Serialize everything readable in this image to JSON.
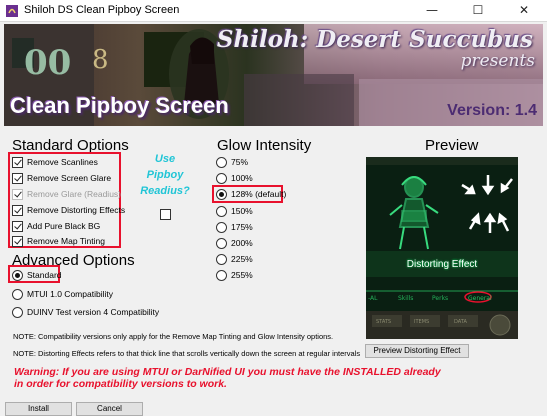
{
  "window": {
    "title": "Shiloh DS Clean Pipboy Screen",
    "minimize_glyph": "—",
    "maximize_glyph": "☐",
    "close_glyph": "✕"
  },
  "banner": {
    "headline": "Shiloh: Desert Succubus",
    "presents": "presents",
    "title": "Clean Pipboy Screen",
    "version": "Version: 1.4"
  },
  "standard_options": {
    "heading": "Standard Options",
    "items": [
      {
        "label": "Remove Scanlines",
        "checked": true,
        "enabled": true
      },
      {
        "label": "Remove Screen Glare",
        "checked": true,
        "enabled": true
      },
      {
        "label": "Remove Glare (Readius)",
        "checked": true,
        "enabled": false
      },
      {
        "label": "Remove Distorting Effects",
        "checked": true,
        "enabled": true
      },
      {
        "label": "Add Pure Black BG",
        "checked": true,
        "enabled": true
      },
      {
        "label": "Remove Map Tinting",
        "checked": true,
        "enabled": true
      }
    ]
  },
  "pipboy_readius": {
    "line1": "Use",
    "line2": "Pipboy",
    "line3": "Readius?",
    "checked": false
  },
  "advanced_options": {
    "heading": "Advanced Options",
    "items": [
      {
        "label": "Standard",
        "selected": true
      },
      {
        "label": "MTUI 1.0 Compatibility",
        "selected": false
      },
      {
        "label": "DUINV Test version 4 Compatibility",
        "selected": false
      }
    ]
  },
  "glow_intensity": {
    "heading": "Glow Intensity",
    "options": [
      {
        "label": "75%",
        "selected": false
      },
      {
        "label": "100%",
        "selected": false
      },
      {
        "label": "128% (default)",
        "selected": true
      },
      {
        "label": "150%",
        "selected": false
      },
      {
        "label": "175%",
        "selected": false
      },
      {
        "label": "200%",
        "selected": false
      },
      {
        "label": "225%",
        "selected": false
      },
      {
        "label": "255%",
        "selected": false
      }
    ]
  },
  "preview": {
    "heading": "Preview",
    "caption": "Distorting Effect",
    "tab_1": "Skills",
    "tab_2": "Perks",
    "tab_3": "General",
    "bottom_1": "STATS",
    "bottom_2": "ITEMS",
    "bottom_3": "DATA"
  },
  "notes": {
    "compatibility": "NOTE: Compatibility versions only apply for the Remove Map Tinting and Glow Intensity options.",
    "distorting": "NOTE: Distorting Effects refers to that thick line that scrolls vertically down the screen at regular intervals"
  },
  "buttons": {
    "preview_distorting": "Preview Distorting Effect",
    "install": "Install",
    "cancel": "Cancel"
  },
  "warning": {
    "line1": "Warning: If you are using MTUI or DarNified UI  you must have the INSTALLED already",
    "line2": "in order for compatibility versions to work."
  },
  "colors": {
    "highlight_box": "#e8112d",
    "readius_text": "#21c5d6",
    "warning_text": "#e8112d",
    "pipboy_green": "#2bd46b"
  }
}
